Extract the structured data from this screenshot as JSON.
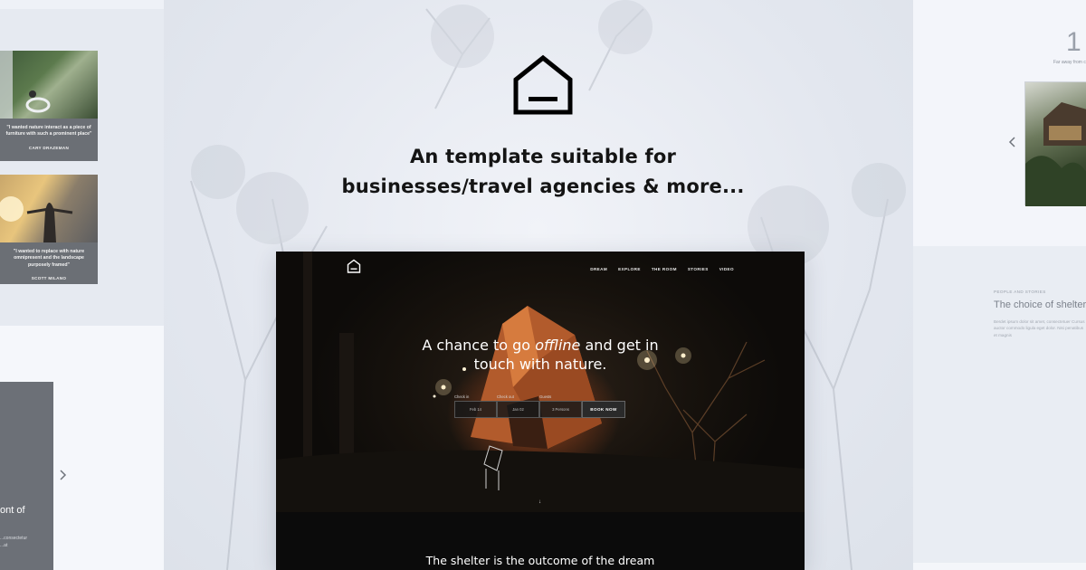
{
  "headline": {
    "line1": "An template suitable for",
    "line2": "businesses/travel agencies & more..."
  },
  "left_cards": [
    {
      "quote": "\"I wanted nature interact as a piece of furniture with such a prominent place\"",
      "author": "CARY DRAZEMAN"
    },
    {
      "quote": "\"I wanted to replace with nature omnipresent and the landscape purposely framed\"",
      "author": "SCOTT MILANO"
    }
  ],
  "left_bottom": {
    "title_fragment": "ont of",
    "small_text_1": "...consectetur",
    "small_text_2": "...at"
  },
  "right_panel": {
    "number": "1",
    "caption": "Far away from c",
    "section_label": "PEOPLE AND STORIES",
    "title": "The choice of shelter",
    "body": "Berdet ipsum dolor sit amet, consectetuer Cursus auctor commodo ligula eget dolor. Nisi penatibus et magnis"
  },
  "mock": {
    "nav": [
      "DREAM",
      "EXPLORE",
      "THE ROOM",
      "STORIES",
      "VIDEO"
    ],
    "hero_pre": "A chance to go ",
    "hero_italic": "offline",
    "hero_post": " and get in",
    "hero_line2": "touch with nature.",
    "booking": {
      "checkin_label": "Check in",
      "checkout_label": "Check out",
      "guests_label": "Guests",
      "checkin_value": "Feb 14",
      "checkout_value": "Jan 02",
      "guests_value": "3 Persons",
      "book_label": "BOOK NOW"
    },
    "scroll_arrow": "↓",
    "section_title": "The shelter is the outcome of the dream"
  },
  "icons": [
    "house-logo-icon",
    "chevron-right-icon",
    "chevron-left-icon",
    "arrow-down-icon"
  ]
}
